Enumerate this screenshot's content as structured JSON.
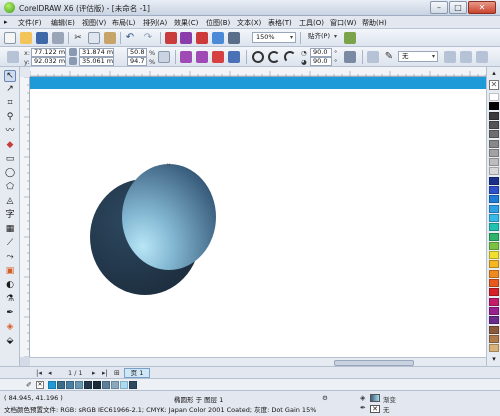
{
  "window": {
    "title": "CorelDRAW X6 (评估版) - [未命名 -1]",
    "minimize": "–",
    "maximize": "□",
    "close": "✕"
  },
  "menu": [
    "文件(F)",
    "编辑(E)",
    "视图(V)",
    "布局(L)",
    "排列(A)",
    "效果(C)",
    "位图(B)",
    "文本(X)",
    "表格(T)",
    "工具(O)",
    "窗口(W)",
    "帮助(H)"
  ],
  "standard_toolbar": {
    "zoom": "150%",
    "snap": "贴齐(P)"
  },
  "property_bar": {
    "x_label": "x:",
    "x": "77.122 mm",
    "y_label": "y:",
    "y": "92.032 mm",
    "width": "31.874 mm",
    "height": "35.061 mm",
    "scale_w": "50.8",
    "scale_h": "94.7",
    "percent": "%",
    "angle_start": "90.0",
    "angle_end": "90.0",
    "degree": "°",
    "outline": "无"
  },
  "page_nav": {
    "counter": "1 / 1",
    "tab": "页 1"
  },
  "status": {
    "coords": "( 84.945, 41.196 )",
    "selection": "椭圆形 于 图层 1",
    "color_profile": "文档颜色预置文件: RGB: sRGB IEC61966-2.1; CMYK: Japan Color 2001 Coated; 灰度: Dot Gain 15%",
    "fill_label": "渐变",
    "outline_label": "无"
  },
  "colors": {
    "page_bar": "#1d9ad7",
    "back_circle": "#23384c",
    "front_circle_light": "#a9dcf2",
    "front_circle_dark": "#3d5f7d"
  },
  "palette_colors": [
    "#ffffff",
    "#000000",
    "#3a3a3a",
    "#555555",
    "#6e6e6e",
    "#888888",
    "#a2a2a2",
    "#bcbcbc",
    "#d6d6d6",
    "#1a2f8a",
    "#2e50c8",
    "#1e7bd6",
    "#2ea0e6",
    "#36b8e8",
    "#21c0b0",
    "#2db36a",
    "#7cc242",
    "#f0e02c",
    "#f7b51f",
    "#f08a1c",
    "#e85a1c",
    "#d61f26",
    "#c21c6a",
    "#9b1f8e",
    "#6a2a8e",
    "#8a5a3a",
    "#b07a4a",
    "#d8b07a"
  ],
  "doc_palette_colors": [
    "#1d9ad7",
    "#3b6c8c",
    "#4a7ea3",
    "#6897b3",
    "#23384c",
    "#1a2b3a",
    "#5d7f9a",
    "#8aa9bd",
    "#a9dcf2",
    "#2d4a63"
  ]
}
